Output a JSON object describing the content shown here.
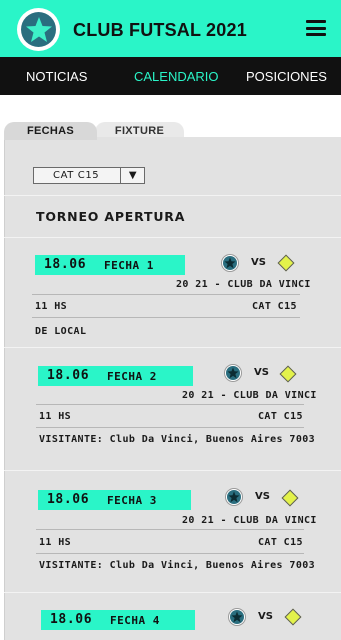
{
  "header": {
    "title": "CLUB FUTSAL 2021",
    "logo_icon": "star-badge-icon",
    "menu_icon": "hamburger-menu-icon"
  },
  "nav": [
    {
      "label": "NOTICIAS",
      "active": false
    },
    {
      "label": "CALENDARIO",
      "active": true
    },
    {
      "label": "POSICIONES",
      "active": false
    }
  ],
  "tabs": [
    {
      "label": "FECHAS",
      "active": true
    },
    {
      "label": "FIXTURE",
      "active": false
    }
  ],
  "category_select": {
    "value": "CAT C15",
    "arrow": "▼"
  },
  "tournament": "TORNEO APERTURA",
  "matches": [
    {
      "date": "18.06",
      "fecha": "FECHA 1",
      "vs": "VS",
      "teams": "20 21 - CLUB DA VINCI",
      "time": "11 HS",
      "category": "CAT C15",
      "location": "DE LOCAL"
    },
    {
      "date": "18.06",
      "fecha": "FECHA 2",
      "vs": "VS",
      "teams": "20 21 - CLUB DA VINCI",
      "time": "11 HS",
      "category": "CAT C15",
      "location": "VISITANTE: Club Da Vinci, Buenos Aires 7003"
    },
    {
      "date": "18.06",
      "fecha": "FECHA 3",
      "vs": "VS",
      "teams": "20 21 - CLUB DA VINCI",
      "time": "11 HS",
      "category": "CAT C15",
      "location": "VISITANTE: Club Da Vinci, Buenos Aires 7003"
    },
    {
      "date": "18.06",
      "fecha": "FECHA 4",
      "vs": "VS"
    }
  ],
  "colors": {
    "accent": "#2af5c8",
    "navbar": "#111111",
    "panel": "#e2e2e2",
    "home_badge": "#2a6e7f",
    "away_badge": "#e3f24b"
  }
}
